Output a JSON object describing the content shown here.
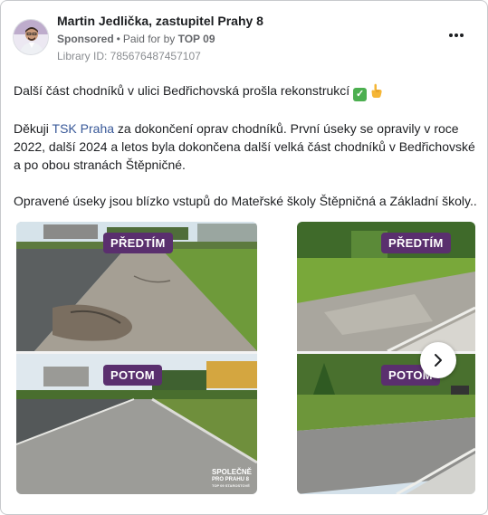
{
  "post": {
    "author": "Martin Jedlička, zastupitel Prahy 8",
    "sponsored_label": "Sponsored",
    "dot": "•",
    "paid_for_label": "Paid for by",
    "payer": "TOP 09",
    "library_id": "Library ID: 785676487457107",
    "line1": "Další část chodníků v ulici Bedřichovská prošla rekonstrukcí",
    "check_emoji": "✓",
    "p2_before_link": "Děkuji ",
    "p2_link": "TSK Praha",
    "p2_after_link": " za dokončení oprav chodníků. První úseky se opravily v roce 2022, další 2024 a letos byla dokončena další velká část chodníků v Bedřichovské a po obou stranách Štěpničné.",
    "p3": "Opravené úseky jsou blízko vstupů do Mateřské školy Štěpničná a Základní školy..."
  },
  "carousel": {
    "before_label": "PŘEDTÍM",
    "after_label": "POTOM",
    "brand_line1": "SPOLEČNĚ",
    "brand_line2": "PRO PRAHU 8",
    "brand_line3": "TOP 09  STAROSTOVÉ"
  },
  "colors": {
    "label_bg": "#5a2f6e",
    "link": "#385898",
    "check": "#4caf50"
  },
  "icons": {
    "more": "more-options-icon",
    "next": "chevron-right-icon",
    "check": "check-mark-icon",
    "hand": "pointing-hand-icon"
  }
}
